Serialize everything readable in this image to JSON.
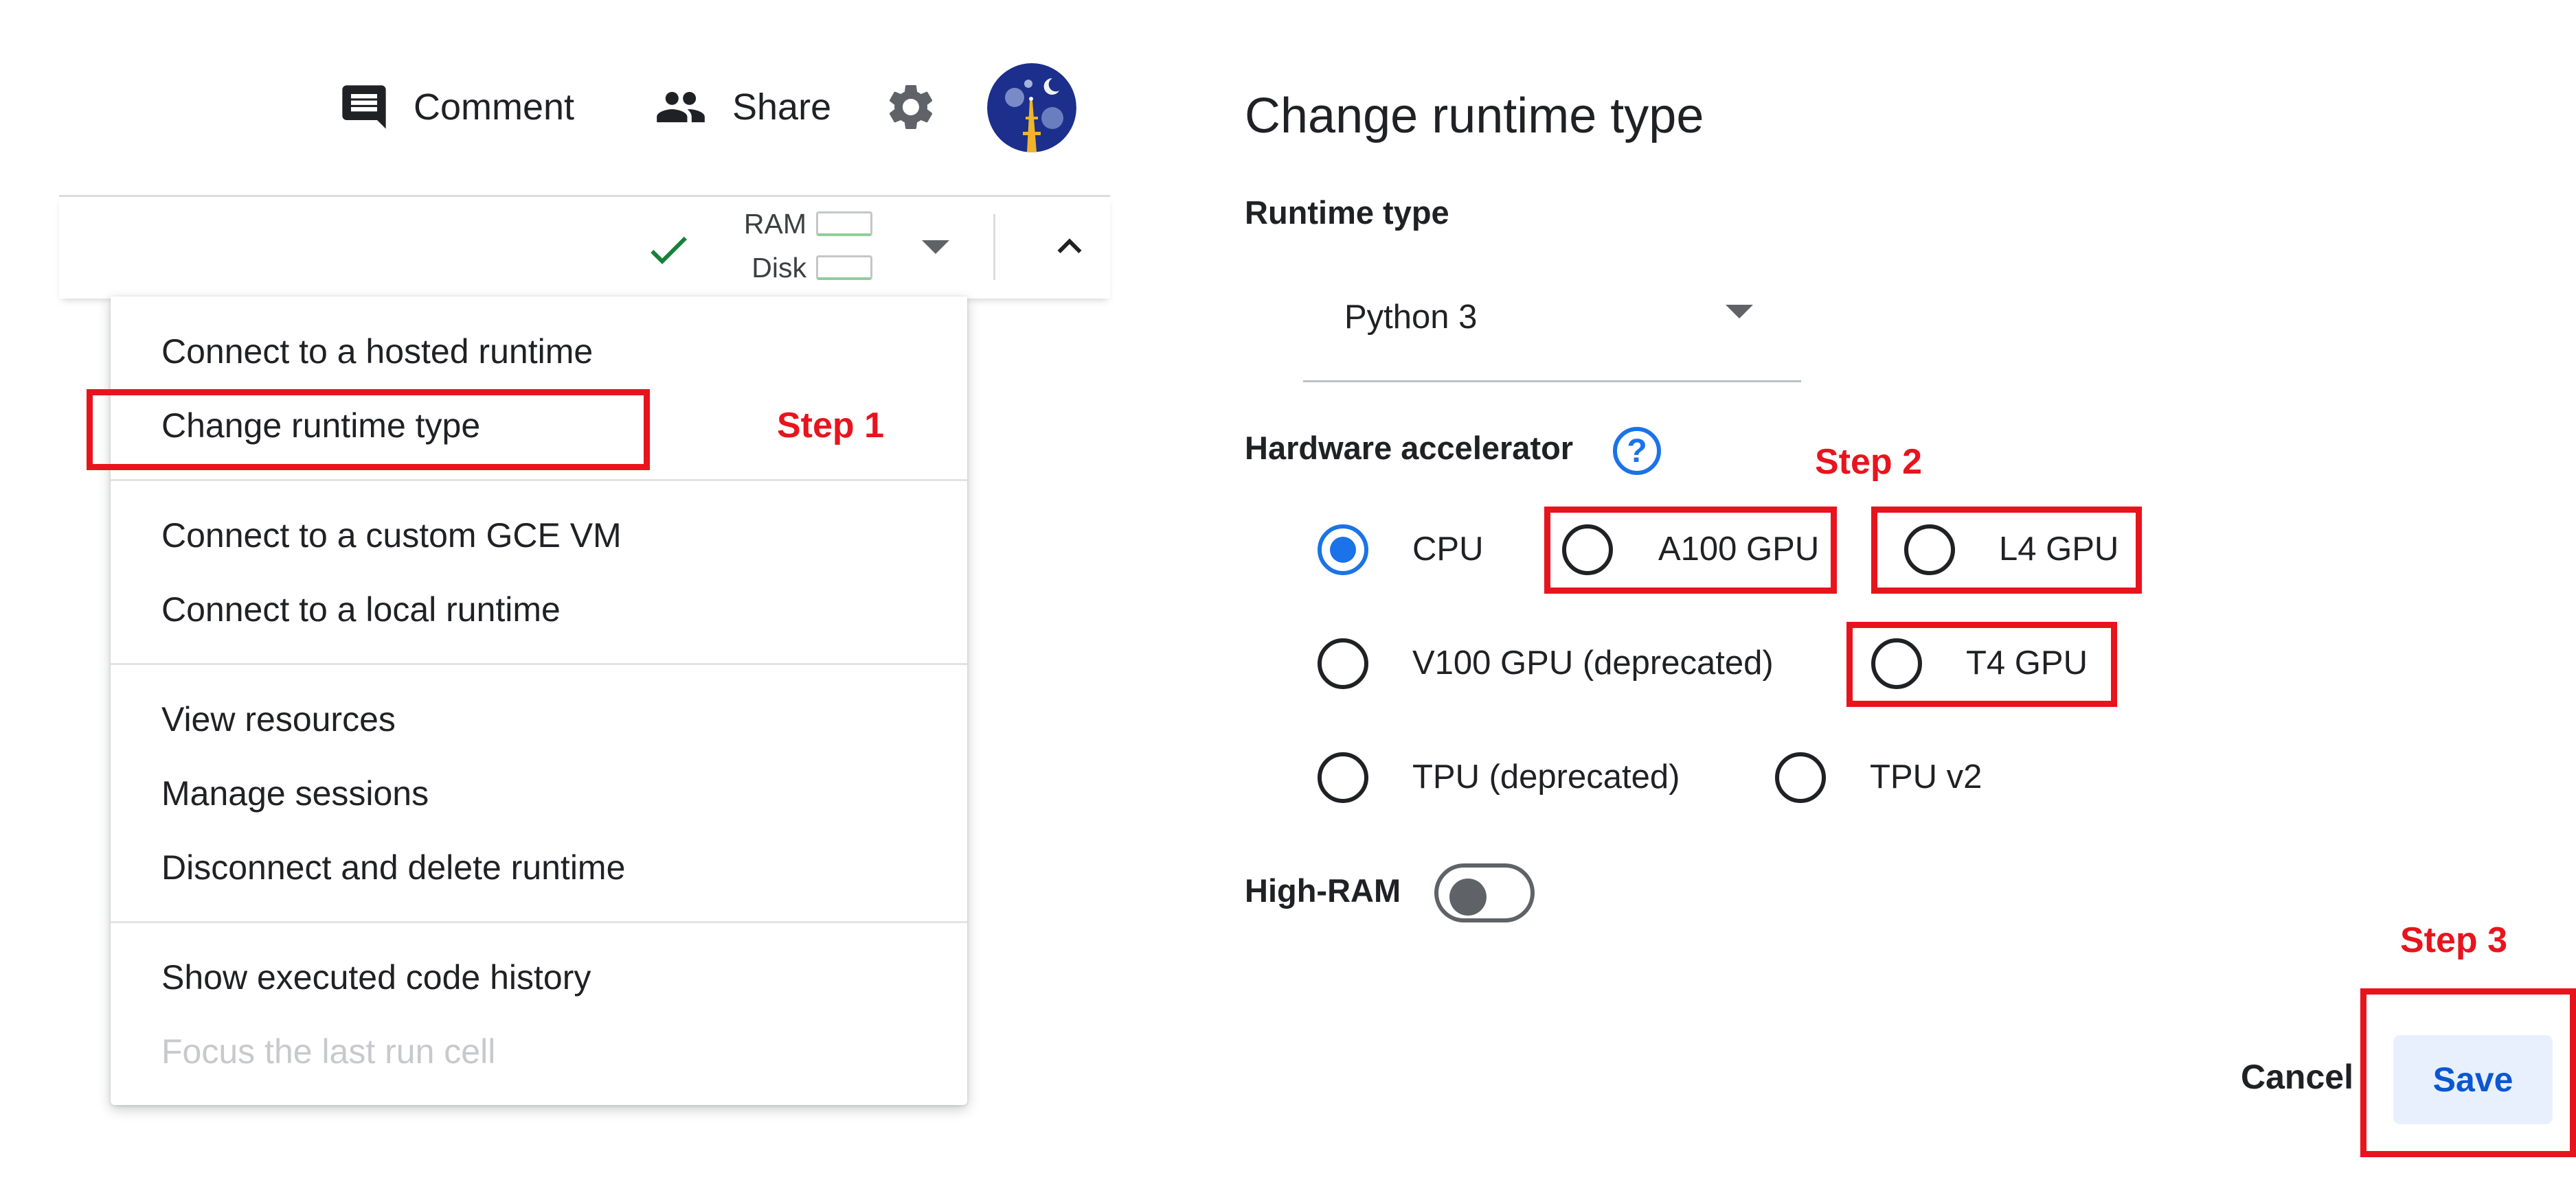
{
  "header": {
    "comment_label": "Comment",
    "share_label": "Share",
    "icons": {
      "comment": "comment-icon",
      "share": "people-icon",
      "settings": "gear-icon",
      "avatar": "user-avatar"
    }
  },
  "toolbar": {
    "ram_label": "RAM",
    "disk_label": "Disk",
    "icons": {
      "status": "checkmark-icon",
      "dropdown": "caret-down-icon",
      "collapse": "chevron-up-icon"
    },
    "colors": {
      "check": "#188038"
    }
  },
  "menu": {
    "items": [
      {
        "label": "Connect to a hosted runtime",
        "enabled": true
      },
      {
        "label": "Change runtime type",
        "enabled": true
      },
      {
        "label": "Connect to a custom GCE VM",
        "enabled": true
      },
      {
        "label": "Connect to a local runtime",
        "enabled": true
      },
      {
        "label": "View resources",
        "enabled": true
      },
      {
        "label": "Manage sessions",
        "enabled": true
      },
      {
        "label": "Disconnect and delete runtime",
        "enabled": true
      },
      {
        "label": "Show executed code history",
        "enabled": true
      },
      {
        "label": "Focus the last run cell",
        "enabled": false
      }
    ]
  },
  "annotations": {
    "step1": "Step 1",
    "step2": "Step 2",
    "step3": "Step 3",
    "color": "#e8141d"
  },
  "dialog": {
    "title": "Change runtime type",
    "runtime_type_label": "Runtime type",
    "runtime_type_value": "Python 3",
    "hardware_label": "Hardware accelerator",
    "help_icon": "help-circle-icon",
    "options": [
      {
        "label": "CPU",
        "selected": true
      },
      {
        "label": "A100 GPU",
        "selected": false
      },
      {
        "label": "L4 GPU",
        "selected": false
      },
      {
        "label": "V100 GPU (deprecated)",
        "selected": false
      },
      {
        "label": "T4 GPU",
        "selected": false
      },
      {
        "label": "TPU (deprecated)",
        "selected": false
      },
      {
        "label": "TPU v2",
        "selected": false
      }
    ],
    "high_ram_label": "High-RAM",
    "high_ram_on": false,
    "cancel_label": "Cancel",
    "save_label": "Save",
    "colors": {
      "accent": "#1a73e8",
      "save_bg": "#e8f0fe",
      "save_text": "#0b57d0"
    }
  }
}
